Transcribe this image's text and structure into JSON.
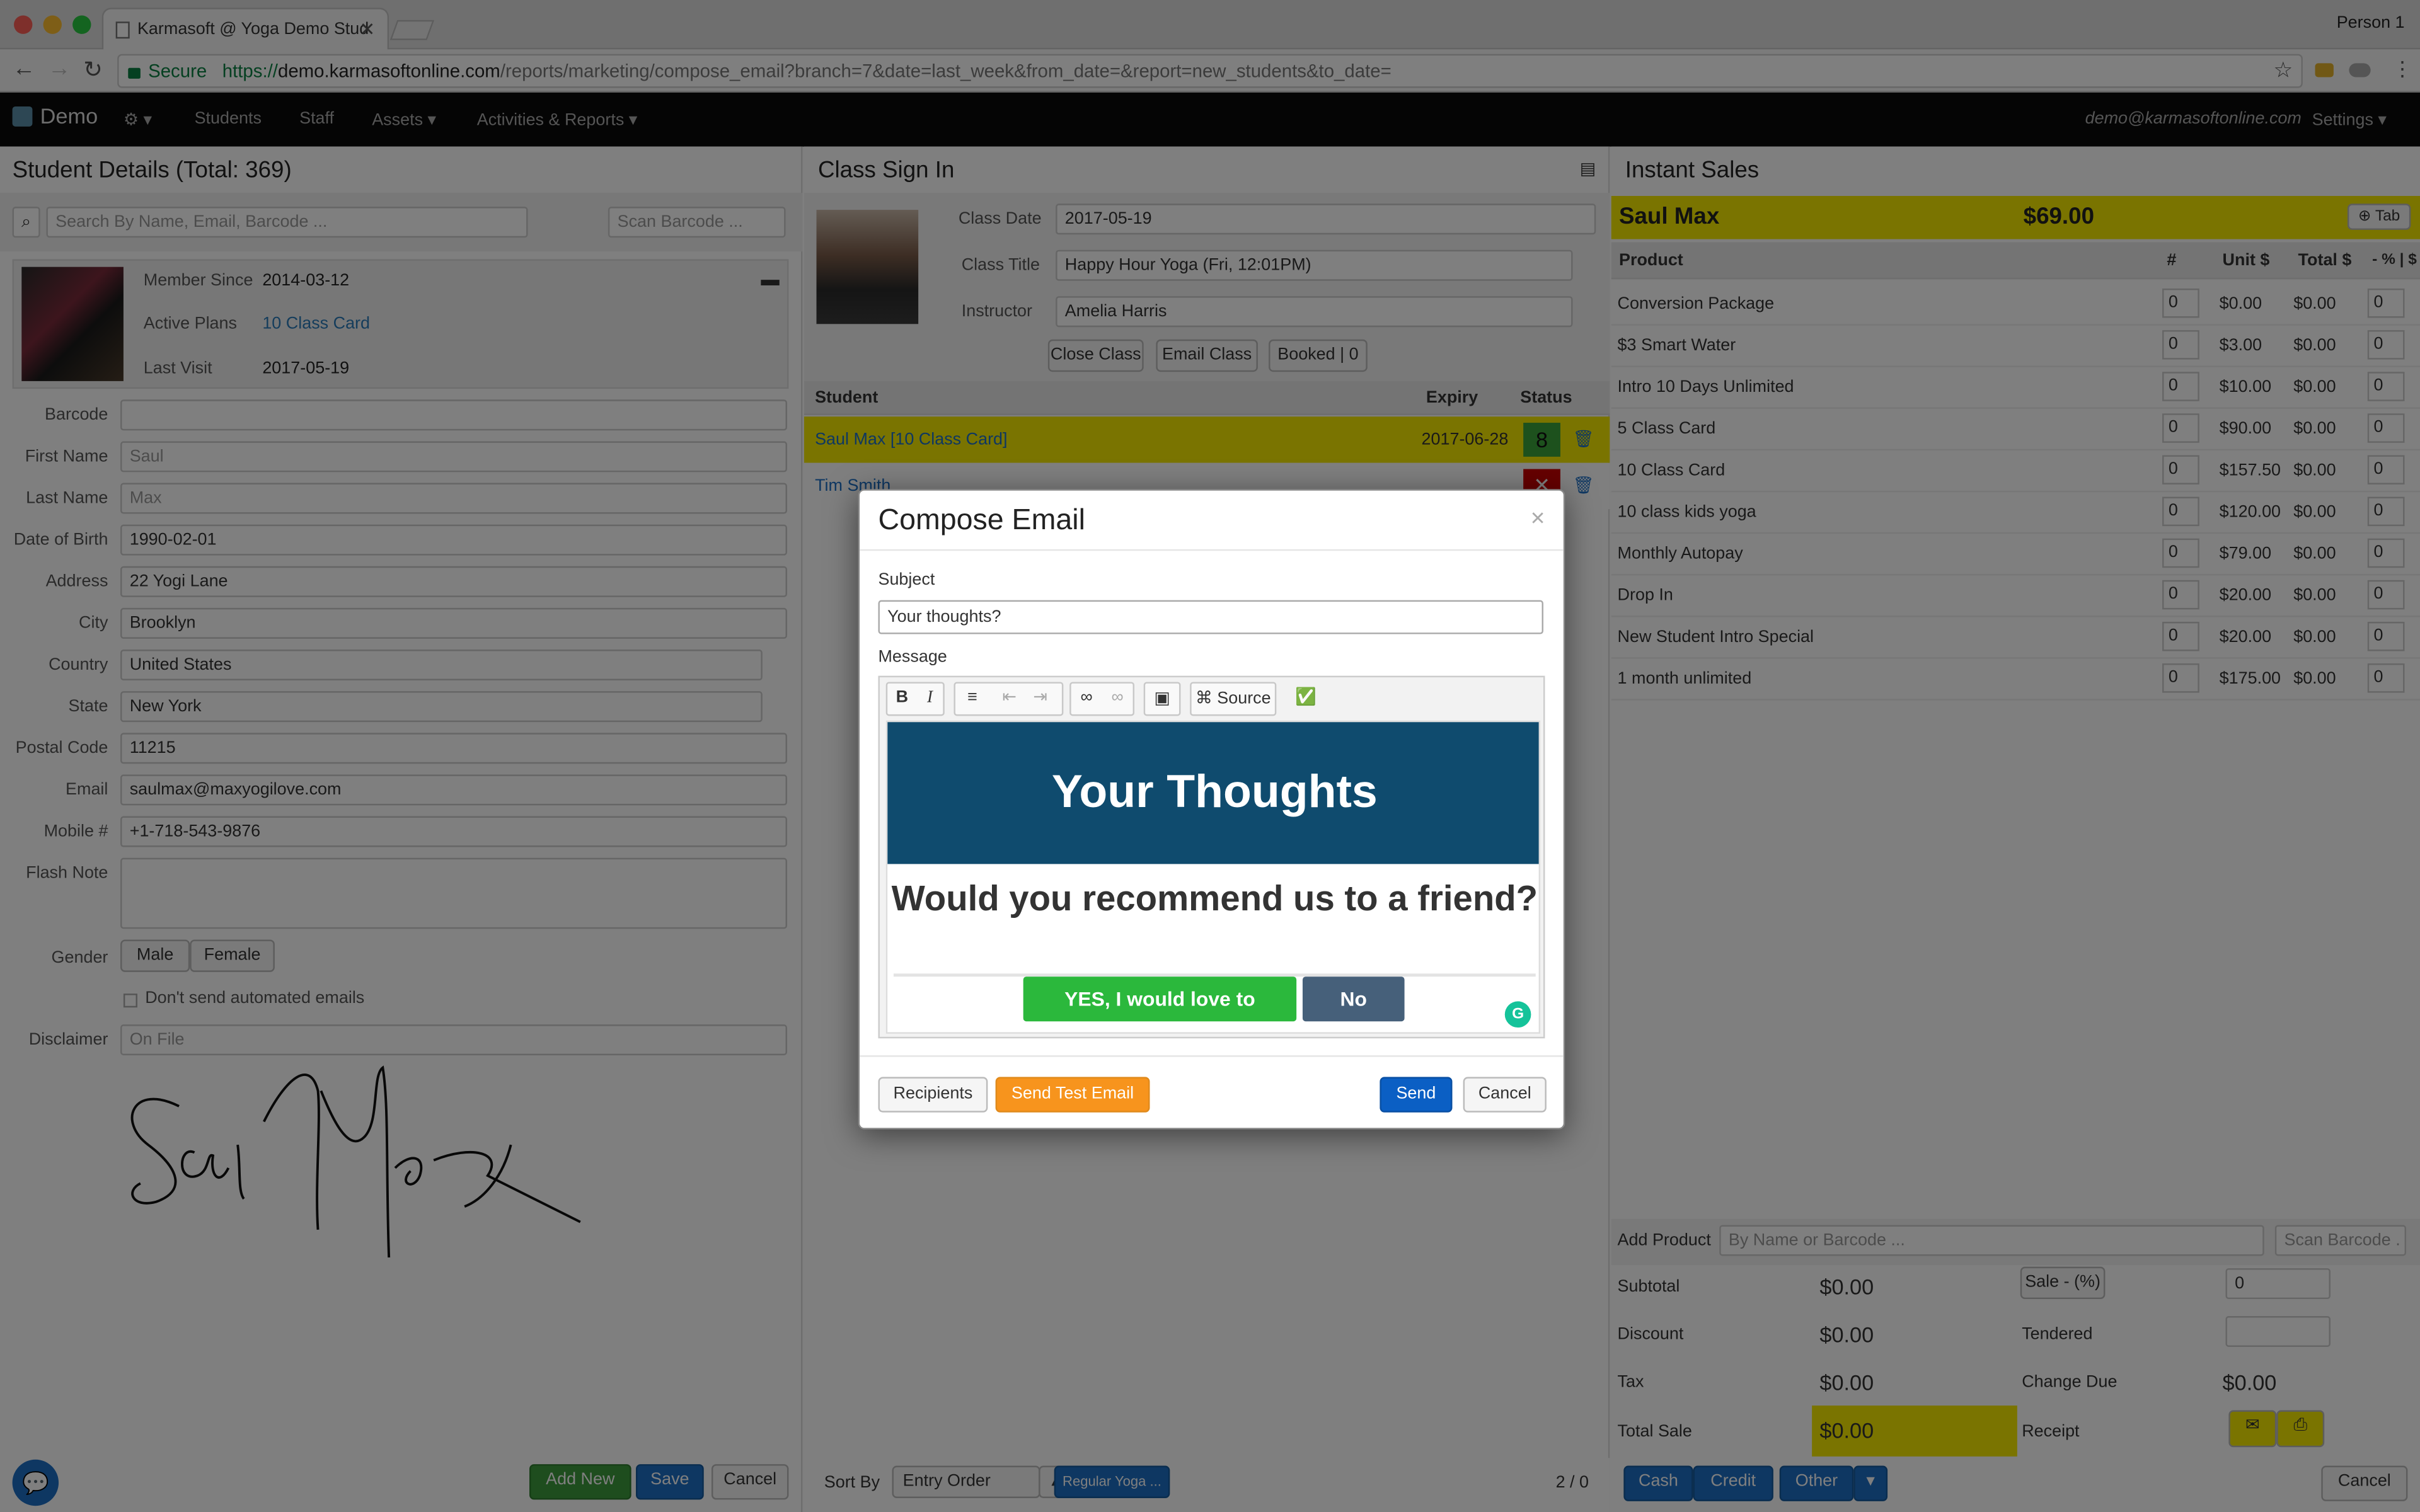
{
  "browser": {
    "tab_title": "Karmasoft @ Yoga Demo Stud",
    "person": "Person 1",
    "secure_label": "Secure",
    "url_scheme": "https://",
    "url_host": "demo.karmasoftonline.com",
    "url_path": "/reports/marketing/compose_email?branch=7&date=last_week&from_date=&report=new_students&to_date="
  },
  "nav": {
    "brand": "Demo",
    "items": [
      "Students",
      "Staff",
      "Assets ▾",
      "Activities & Reports ▾"
    ],
    "user_email": "demo@karmasoftonline.com",
    "settings": "Settings ▾"
  },
  "student_details": {
    "title": "Student Details (Total: 369)",
    "search_placeholder": "Search By Name, Email, Barcode ...",
    "scan_placeholder": "Scan Barcode ...",
    "member_since_label": "Member Since",
    "member_since": "2014-03-12",
    "active_plans_label": "Active Plans",
    "active_plans": "10 Class Card",
    "last_visit_label": "Last Visit",
    "last_visit": "2017-05-19",
    "fields": [
      {
        "label": "Barcode",
        "value": ""
      },
      {
        "label": "First Name",
        "value": "Saul"
      },
      {
        "label": "Last Name",
        "value": "Max"
      },
      {
        "label": "Date of Birth",
        "value": "1990-02-01"
      },
      {
        "label": "Address",
        "value": "22 Yogi Lane"
      },
      {
        "label": "City",
        "value": "Brooklyn"
      },
      {
        "label": "Country",
        "value": "United States"
      },
      {
        "label": "State",
        "value": "New York"
      },
      {
        "label": "Postal Code",
        "value": "11215"
      },
      {
        "label": "Email",
        "value": "saulmax@maxyogilove.com"
      },
      {
        "label": "Mobile #",
        "value": "+1-718-543-9876"
      }
    ],
    "flash_note_label": "Flash Note",
    "gender_label": "Gender",
    "gender_male": "Male",
    "gender_female": "Female",
    "no_auto_email": "Don't send automated emails",
    "disclaimer_label": "Disclaimer",
    "disclaimer_value": "On File",
    "add_new": "Add New",
    "save": "Save",
    "cancel": "Cancel"
  },
  "class_sign_in": {
    "title": "Class Sign In",
    "class_date_label": "Class Date",
    "class_date": "2017-05-19",
    "class_title_label": "Class Title",
    "class_title": "Happy Hour Yoga (Fri, 12:01PM)",
    "instructor_label": "Instructor",
    "instructor": "Amelia Harris",
    "close_class": "Close Class",
    "email_class": "Email Class",
    "booked": "Booked | 0",
    "col_student": "Student",
    "col_expiry": "Expiry",
    "col_status": "Status",
    "rows": [
      {
        "name": "Saul Max [10 Class Card]",
        "expiry": "2017-06-28",
        "status": "8"
      },
      {
        "name": "Tim Smith",
        "expiry": "",
        "status": "✕"
      }
    ],
    "sort_by_label": "Sort By",
    "sort_by": "Entry Order",
    "filter": "Regular Yoga ...",
    "page": "2 / 0"
  },
  "instant_sales": {
    "title": "Instant Sales",
    "customer": "Saul Max",
    "amount": "$69.00",
    "tab_btn": "Tab",
    "col_product": "Product",
    "col_qty": "#",
    "col_unit": "Unit $",
    "col_total": "Total $",
    "col_disc": "- % | $",
    "products": [
      {
        "name": "Conversion Package",
        "qty": "0",
        "unit": "$0.00",
        "total": "$0.00",
        "disc": "0"
      },
      {
        "name": "$3 Smart Water",
        "qty": "0",
        "unit": "$3.00",
        "total": "$0.00",
        "disc": "0"
      },
      {
        "name": "Intro 10 Days Unlimited",
        "qty": "0",
        "unit": "$10.00",
        "total": "$0.00",
        "disc": "0"
      },
      {
        "name": "5 Class Card",
        "qty": "0",
        "unit": "$90.00",
        "total": "$0.00",
        "disc": "0"
      },
      {
        "name": "10 Class Card",
        "qty": "0",
        "unit": "$157.50",
        "total": "$0.00",
        "disc": "0"
      },
      {
        "name": "10 class kids yoga",
        "qty": "0",
        "unit": "$120.00",
        "total": "$0.00",
        "disc": "0"
      },
      {
        "name": "Monthly Autopay",
        "qty": "0",
        "unit": "$79.00",
        "total": "$0.00",
        "disc": "0"
      },
      {
        "name": "Drop In",
        "qty": "0",
        "unit": "$20.00",
        "total": "$0.00",
        "disc": "0"
      },
      {
        "name": "New Student Intro Special",
        "qty": "0",
        "unit": "$20.00",
        "total": "$0.00",
        "disc": "0"
      },
      {
        "name": "1 month unlimited",
        "qty": "0",
        "unit": "$175.00",
        "total": "$0.00",
        "disc": "0"
      }
    ],
    "add_product_label": "Add Product",
    "add_product_placeholder": "By Name or Barcode ...",
    "scan_placeholder": "Scan Barcode .",
    "subtotal_label": "Subtotal",
    "subtotal": "$0.00",
    "discount_label": "Discount",
    "discount": "$0.00",
    "tax_label": "Tax",
    "tax": "$0.00",
    "total_label": "Total Sale",
    "total": "$0.00",
    "sale_disc_btn": "Sale - (%)",
    "sale_disc_val": "0",
    "tendered_label": "Tendered",
    "change_label": "Change Due",
    "change": "$0.00",
    "receipt_label": "Receipt",
    "pay_cash": "Cash",
    "pay_credit": "Credit",
    "pay_other": "Other",
    "cancel": "Cancel"
  },
  "modal": {
    "title": "Compose Email",
    "close": "×",
    "subject_label": "Subject",
    "subject": "Your thoughts?",
    "message_label": "Message",
    "toolbar": {
      "bold": "B",
      "italic": "I",
      "source": "Source",
      "check": "✅"
    },
    "banner": "Your Thoughts",
    "question": "Would you recommend us to a friend?",
    "yes": "YES, I would love to",
    "no": "No",
    "recipients": "Recipients",
    "send_test": "Send Test Email",
    "send": "Send",
    "cancel": "Cancel"
  },
  "colors": {
    "banner": "#0f4b6e",
    "yes": "#2bb83c",
    "no": "#46607a",
    "send": "#0b5fc4",
    "send_test": "#f7941d",
    "highlight": "#f4e800"
  }
}
